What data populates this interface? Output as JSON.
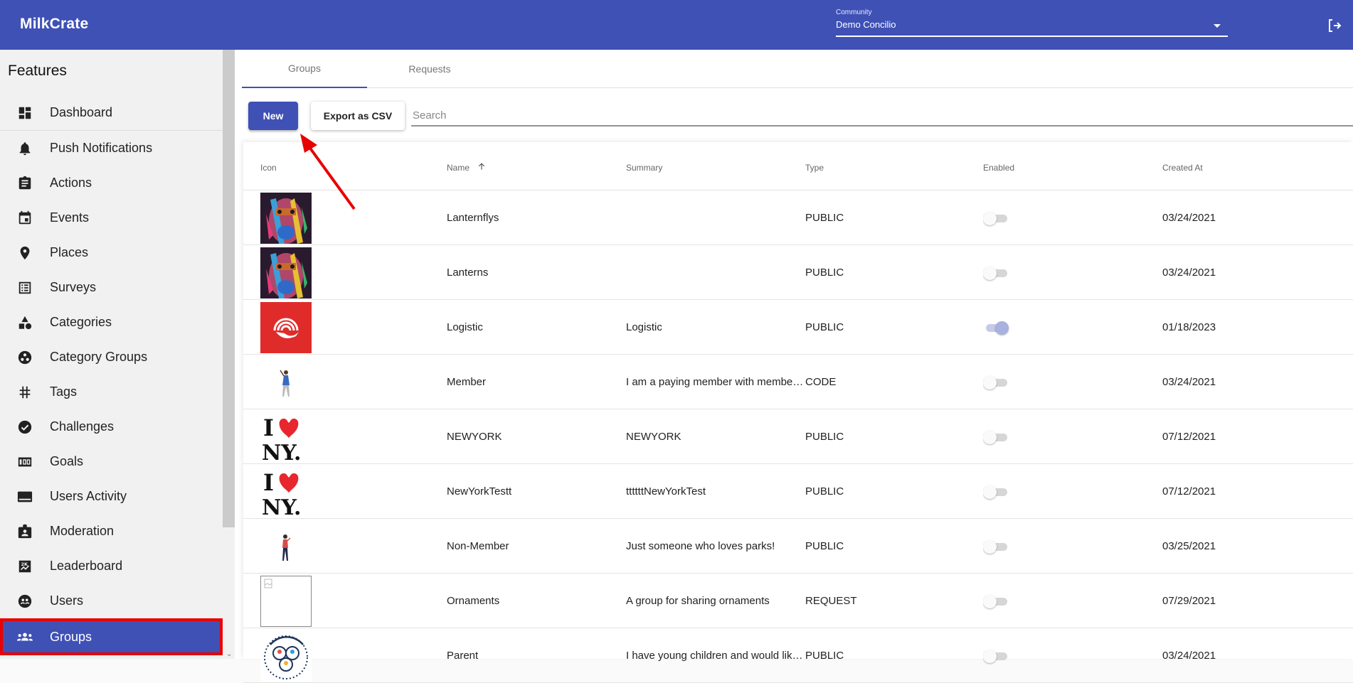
{
  "appbar": {
    "brand": "MilkCrate",
    "community_label": "Community",
    "community_value": "Demo Concilio",
    "logout_icon": "logout-icon"
  },
  "sidebar": {
    "title": "Features",
    "items": [
      {
        "label": "Dashboard",
        "icon": "dashboard-icon"
      },
      {
        "label": "Push Notifications",
        "icon": "bell-icon"
      },
      {
        "label": "Actions",
        "icon": "clipboard-icon"
      },
      {
        "label": "Events",
        "icon": "calendar-icon"
      },
      {
        "label": "Places",
        "icon": "map-pin-icon"
      },
      {
        "label": "Surveys",
        "icon": "list-icon"
      },
      {
        "label": "Categories",
        "icon": "shapes-icon"
      },
      {
        "label": "Category Groups",
        "icon": "workspaces-icon"
      },
      {
        "label": "Tags",
        "icon": "hash-icon"
      },
      {
        "label": "Challenges",
        "icon": "check-circle-icon"
      },
      {
        "label": "Goals",
        "icon": "scoreboard-icon"
      },
      {
        "label": "Users Activity",
        "icon": "activity-icon"
      },
      {
        "label": "Moderation",
        "icon": "badge-icon"
      },
      {
        "label": "Leaderboard",
        "icon": "leaderboard-icon"
      },
      {
        "label": "Users",
        "icon": "users-icon"
      },
      {
        "label": "Groups",
        "icon": "groups-icon",
        "active": true
      }
    ]
  },
  "tabs": [
    {
      "label": "Groups",
      "active": true
    },
    {
      "label": "Requests",
      "active": false
    }
  ],
  "toolbar": {
    "new_label": "New",
    "export_label": "Export as CSV",
    "search_placeholder": "Search",
    "search_value": ""
  },
  "table": {
    "columns": [
      "Icon",
      "Name",
      "Summary",
      "Type",
      "Enabled",
      "Created At"
    ],
    "sort": {
      "column": "Name",
      "direction": "ascending"
    },
    "rows": [
      {
        "icon": "painted-face-image",
        "name": "Lanternflys",
        "summary": "",
        "type": "PUBLIC",
        "enabled": false,
        "created_at": "03/24/2021"
      },
      {
        "icon": "painted-face-image",
        "name": "Lanterns",
        "summary": "",
        "type": "PUBLIC",
        "enabled": false,
        "created_at": "03/24/2021"
      },
      {
        "icon": "united-way-logo",
        "name": "Logistic",
        "summary": "Logistic",
        "type": "PUBLIC",
        "enabled": true,
        "created_at": "01/18/2023"
      },
      {
        "icon": "waving-woman-image",
        "name": "Member",
        "summary": "I am a paying member with membe…",
        "type": "CODE",
        "enabled": false,
        "created_at": "03/24/2021"
      },
      {
        "icon": "i-love-ny-logo",
        "name": "NEWYORK",
        "summary": "NEWYORK",
        "type": "PUBLIC",
        "enabled": false,
        "created_at": "07/12/2021"
      },
      {
        "icon": "i-love-ny-logo",
        "name": "NewYorkTestt",
        "summary": "ttttttNewYorkTest",
        "type": "PUBLIC",
        "enabled": false,
        "created_at": "07/12/2021"
      },
      {
        "icon": "woman-red-shirt-image",
        "name": "Non-Member",
        "summary": "Just someone who loves parks!",
        "type": "PUBLIC",
        "enabled": false,
        "created_at": "03/25/2021"
      },
      {
        "icon": "broken-image",
        "name": "Ornaments",
        "summary": "A group for sharing ornaments",
        "type": "REQUEST",
        "enabled": false,
        "created_at": "07/29/2021"
      },
      {
        "icon": "group-circle-logo",
        "name": "Parent",
        "summary": "I have young children and would lik…",
        "type": "PUBLIC",
        "enabled": false,
        "created_at": "03/24/2021"
      }
    ]
  },
  "colors": {
    "primary": "#3f51b5",
    "annotation_red": "#e80000",
    "sidebar_bg": "#f1f1f1"
  }
}
